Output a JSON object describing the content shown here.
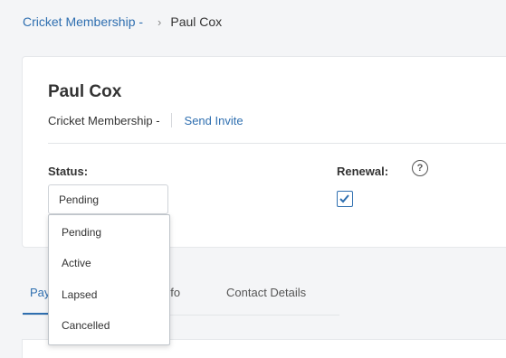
{
  "breadcrumb": {
    "parent": "Cricket Membership -",
    "separator": "›",
    "current": "Paul Cox"
  },
  "member": {
    "name": "Paul Cox",
    "membership": "Cricket Membership -",
    "send_invite": "Send Invite"
  },
  "status": {
    "label": "Status:",
    "selected": "Pending",
    "options": [
      "Pending",
      "Active",
      "Lapsed",
      "Cancelled"
    ]
  },
  "renewal": {
    "label": "Renewal:",
    "checked": true,
    "help": "?"
  },
  "tabs": [
    {
      "label": "Pay",
      "active": true
    },
    {
      "label": "nfo",
      "active": false
    },
    {
      "label": "Contact Details",
      "active": false
    }
  ],
  "colors": {
    "accent": "#2f6fb0",
    "background": "#f4f5f7"
  }
}
